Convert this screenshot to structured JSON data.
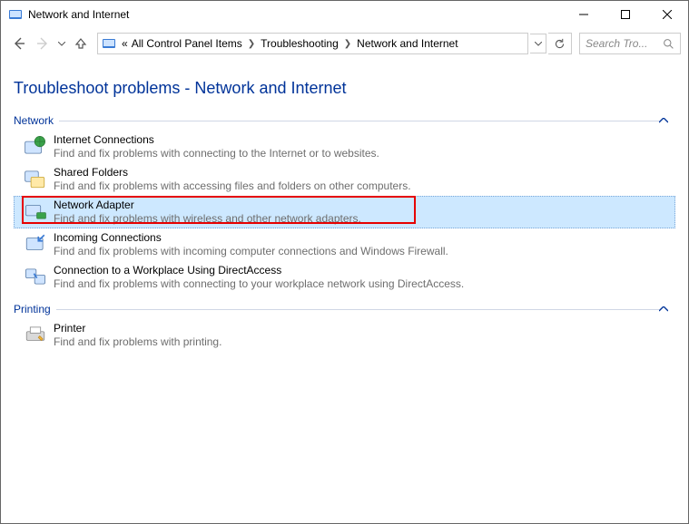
{
  "window": {
    "title": "Network and Internet"
  },
  "breadcrumb": {
    "prefix": "«",
    "segments": [
      "All Control Panel Items",
      "Troubleshooting",
      "Network and Internet"
    ]
  },
  "search": {
    "placeholder": "Search Tro..."
  },
  "page": {
    "heading": "Troubleshoot problems - Network and Internet"
  },
  "sections": {
    "network": {
      "label": "Network",
      "items": [
        {
          "title": "Internet Connections",
          "desc": "Find and fix problems with connecting to the Internet or to websites."
        },
        {
          "title": "Shared Folders",
          "desc": "Find and fix problems with accessing files and folders on other computers."
        },
        {
          "title": "Network Adapter",
          "desc": "Find and fix problems with wireless and other network adapters."
        },
        {
          "title": "Incoming Connections",
          "desc": "Find and fix problems with incoming computer connections and Windows Firewall."
        },
        {
          "title": "Connection to a Workplace Using DirectAccess",
          "desc": "Find and fix problems with connecting to your workplace network using DirectAccess."
        }
      ]
    },
    "printing": {
      "label": "Printing",
      "items": [
        {
          "title": "Printer",
          "desc": "Find and fix problems with printing."
        }
      ]
    }
  }
}
